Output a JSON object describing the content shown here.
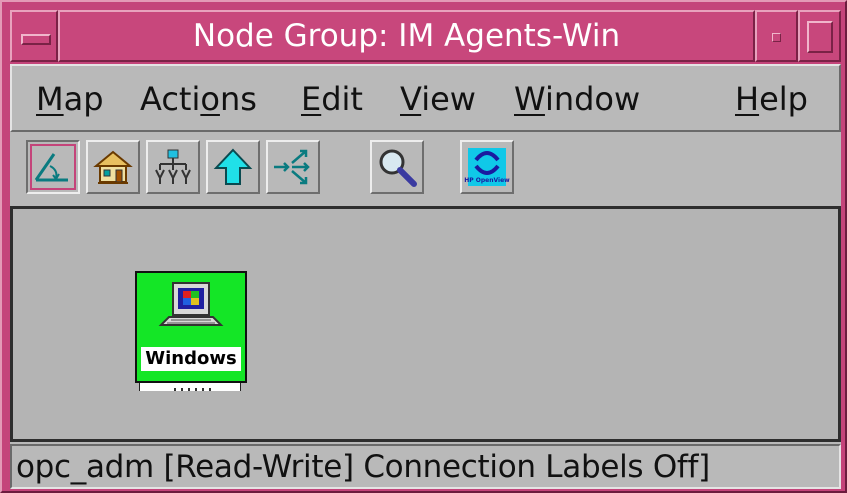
{
  "window": {
    "title": "Node Group: IM Agents-Win"
  },
  "menubar": {
    "items": [
      {
        "label": "Map",
        "mnemonic": "M",
        "rest": "ap"
      },
      {
        "label": "Actions",
        "mnemonic": "Act",
        "mn_char": "o",
        "pre": "Acti",
        "post": "ns"
      },
      {
        "label": "Edit",
        "mnemonic": "E",
        "rest": "dit"
      },
      {
        "label": "View",
        "mnemonic": "V",
        "rest": "iew"
      },
      {
        "label": "Window",
        "mnemonic": "W",
        "rest": "indow"
      },
      {
        "label": "Help",
        "mnemonic": "H",
        "rest": "elp"
      }
    ]
  },
  "toolbar": {
    "tools": [
      {
        "name": "select-tool",
        "icon": "angle-arrow-icon",
        "active": true
      },
      {
        "name": "home-map-tool",
        "icon": "house-icon"
      },
      {
        "name": "root-tree-tool",
        "icon": "tree-hierarchy-icon"
      },
      {
        "name": "parent-up-tool",
        "icon": "up-arrow-icon"
      },
      {
        "name": "explode-tool",
        "icon": "expand-arrows-icon"
      },
      {
        "name": "search-tool",
        "icon": "magnifier-icon"
      },
      {
        "name": "hp-openview-tool",
        "icon": "hp-openview-logo-icon",
        "text": "HP OpenView"
      }
    ]
  },
  "canvas": {
    "nodes": [
      {
        "label": "Windows",
        "icon": "computer-monitor-icon",
        "status_color": "#14e626"
      }
    ]
  },
  "statusbar": {
    "text": "opc_adm [Read-Write] Connection Labels Off]"
  },
  "colors": {
    "frame": "#c4447a",
    "title_text": "#ffffff",
    "background": "#b9b9b9",
    "node_normal": "#14e626"
  }
}
